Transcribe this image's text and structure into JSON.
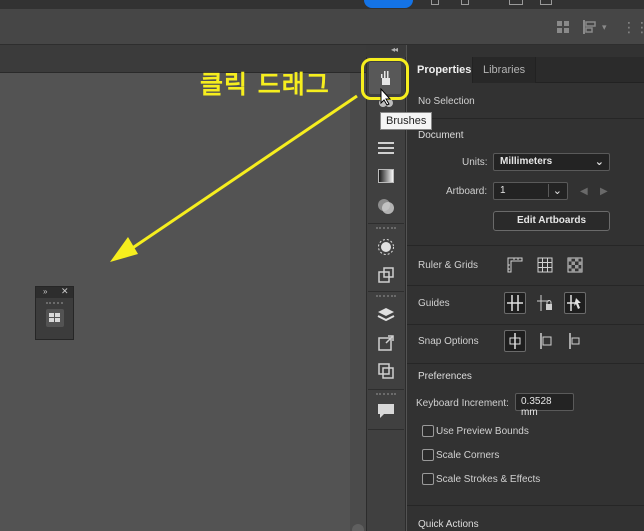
{
  "annotation": {
    "text": "클릭 드래그",
    "color": "#f6ee1e"
  },
  "tooltip": "Brushes",
  "panel": {
    "tabs": [
      {
        "label": "Properties"
      },
      {
        "label": "Libraries"
      }
    ],
    "selection_status": "No Selection",
    "document": {
      "heading": "Document",
      "units_label": "Units:",
      "units_value": "Millimeters",
      "artboard_label": "Artboard:",
      "artboard_value": "1",
      "edit_artboards": "Edit Artboards"
    },
    "ruler_grids_label": "Ruler & Grids",
    "guides_label": "Guides",
    "snap_options_label": "Snap Options",
    "preferences": {
      "heading": "Preferences",
      "keyboard_increment_label": "Keyboard Increment:",
      "keyboard_increment_value": "0.3528 mm",
      "checkboxes": [
        {
          "label": "Use Preview Bounds",
          "checked": false
        },
        {
          "label": "Scale Corners",
          "checked": false
        },
        {
          "label": "Scale Strokes & Effects",
          "checked": false
        }
      ]
    },
    "quick_actions": "Quick Actions"
  },
  "colors": {
    "accent": "#1473e6",
    "panel_bg": "#323232",
    "canvas_bg": "#535353"
  }
}
